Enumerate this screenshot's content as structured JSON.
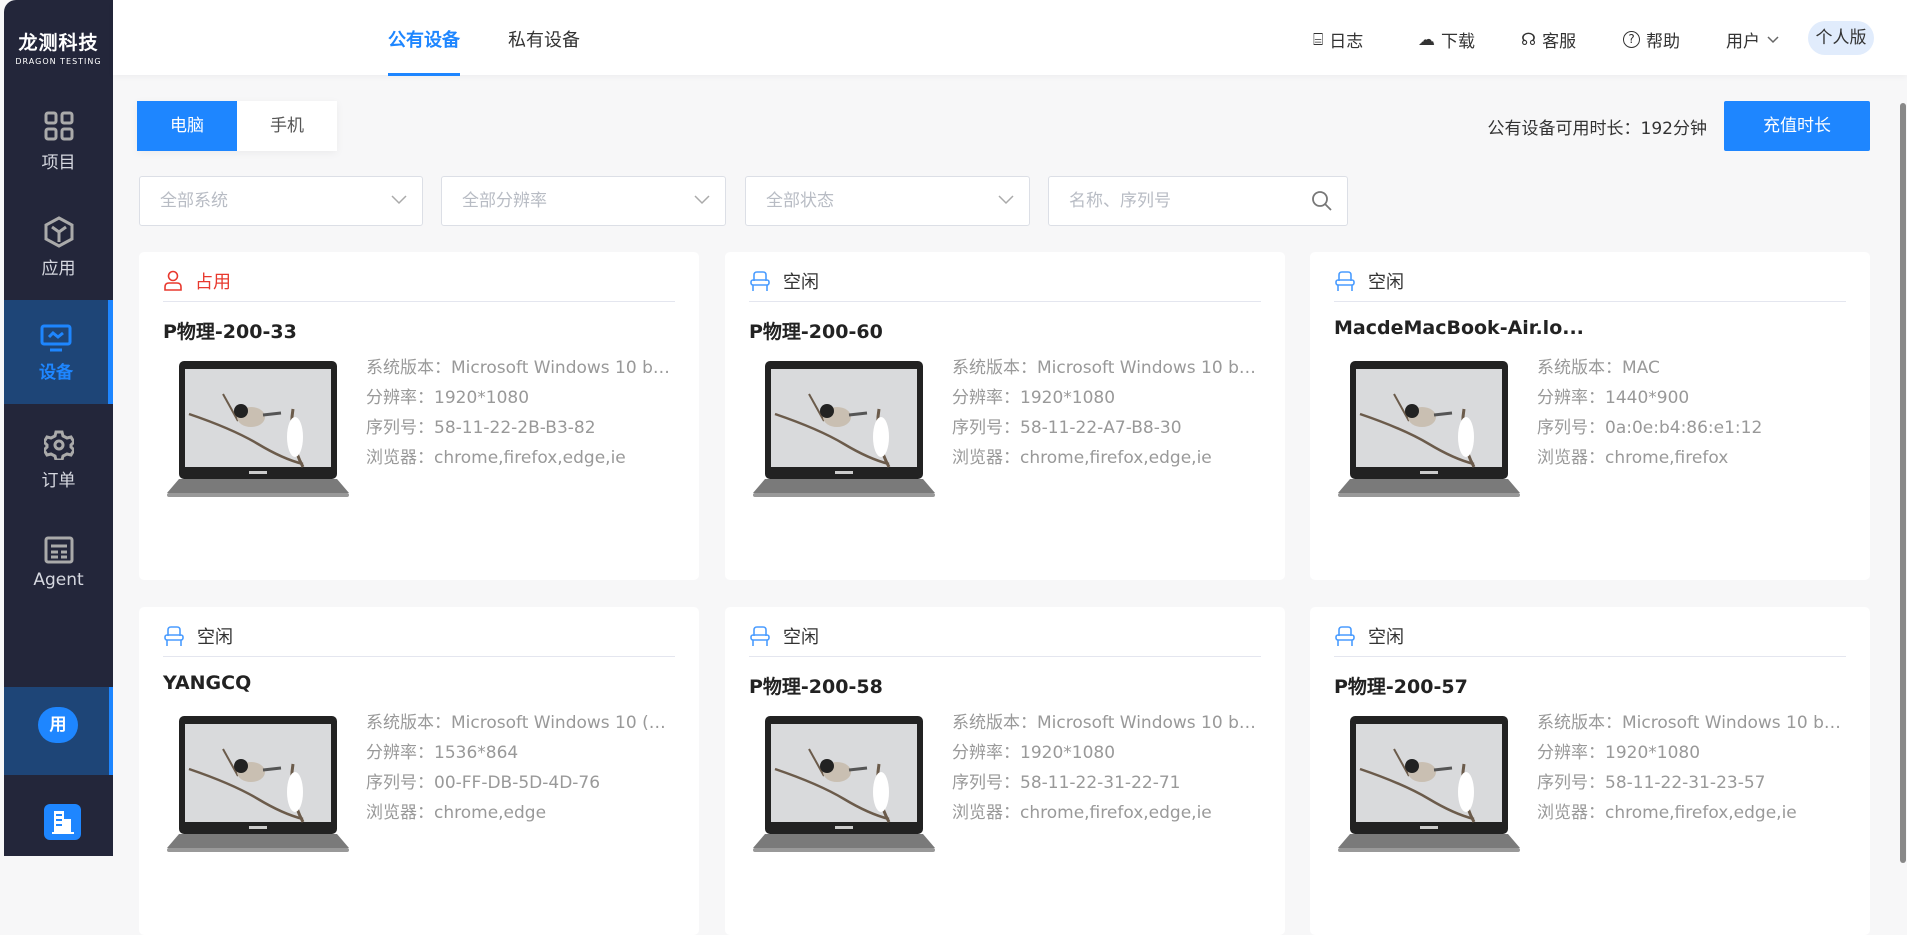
{
  "brand": {
    "cn": "龙测科技",
    "en": "DRAGON TESTING"
  },
  "sidebar": {
    "items": [
      {
        "label": "项目"
      },
      {
        "label": "应用"
      },
      {
        "label": "设备"
      },
      {
        "label": "订单"
      },
      {
        "label": "Agent"
      }
    ],
    "user_badge": "用"
  },
  "header": {
    "tabs": [
      {
        "label": "公有设备"
      },
      {
        "label": "私有设备"
      }
    ],
    "nav": {
      "log": "日志",
      "download": "下载",
      "service": "客服",
      "help": "帮助",
      "user": "用户"
    },
    "edition": "个人版"
  },
  "toolbar": {
    "seg": [
      "电脑",
      "手机"
    ],
    "available": "公有设备可用时长：192分钟",
    "recharge": "充值时长"
  },
  "filters": {
    "os": "全部系统",
    "resolution": "全部分辨率",
    "status": "全部状态",
    "search_placeholder": "名称、序列号"
  },
  "labels": {
    "os": "系统版本：",
    "res": "分辨率：",
    "serial": "序列号：",
    "browser": "浏览器："
  },
  "colors": {
    "accent": "#1e86ff",
    "busy": "#e8392e",
    "idle_icon": "#4a9cff"
  },
  "devices": [
    {
      "status": "占用",
      "busy": true,
      "name": "P物理-200-33",
      "os": "Microsoft Windows 10 buil...",
      "res": "1920*1080",
      "serial": "58-11-22-2B-B3-82",
      "browser": "chrome,firefox,edge,ie"
    },
    {
      "status": "空闲",
      "busy": false,
      "name": "P物理-200-60",
      "os": "Microsoft Windows 10 buil...",
      "res": "1920*1080",
      "serial": "58-11-22-A7-B8-30",
      "browser": "chrome,firefox,edge,ie"
    },
    {
      "status": "空闲",
      "busy": false,
      "name": "MacdeMacBook-Air.lo...",
      "os": "MAC",
      "res": "1440*900",
      "serial": "0a:0e:b4:86:e1:12",
      "browser": "chrome,firefox"
    },
    {
      "status": "空闲",
      "busy": false,
      "name": "YANGCQ",
      "os": "Microsoft Windows 10 (Ho...",
      "res": "1536*864",
      "serial": "00-FF-DB-5D-4D-76",
      "browser": "chrome,edge"
    },
    {
      "status": "空闲",
      "busy": false,
      "name": "P物理-200-58",
      "os": "Microsoft Windows 10 buil...",
      "res": "1920*1080",
      "serial": "58-11-22-31-22-71",
      "browser": "chrome,firefox,edge,ie"
    },
    {
      "status": "空闲",
      "busy": false,
      "name": "P物理-200-57",
      "os": "Microsoft Windows 10 buil...",
      "res": "1920*1080",
      "serial": "58-11-22-31-23-57",
      "browser": "chrome,firefox,edge,ie"
    }
  ]
}
